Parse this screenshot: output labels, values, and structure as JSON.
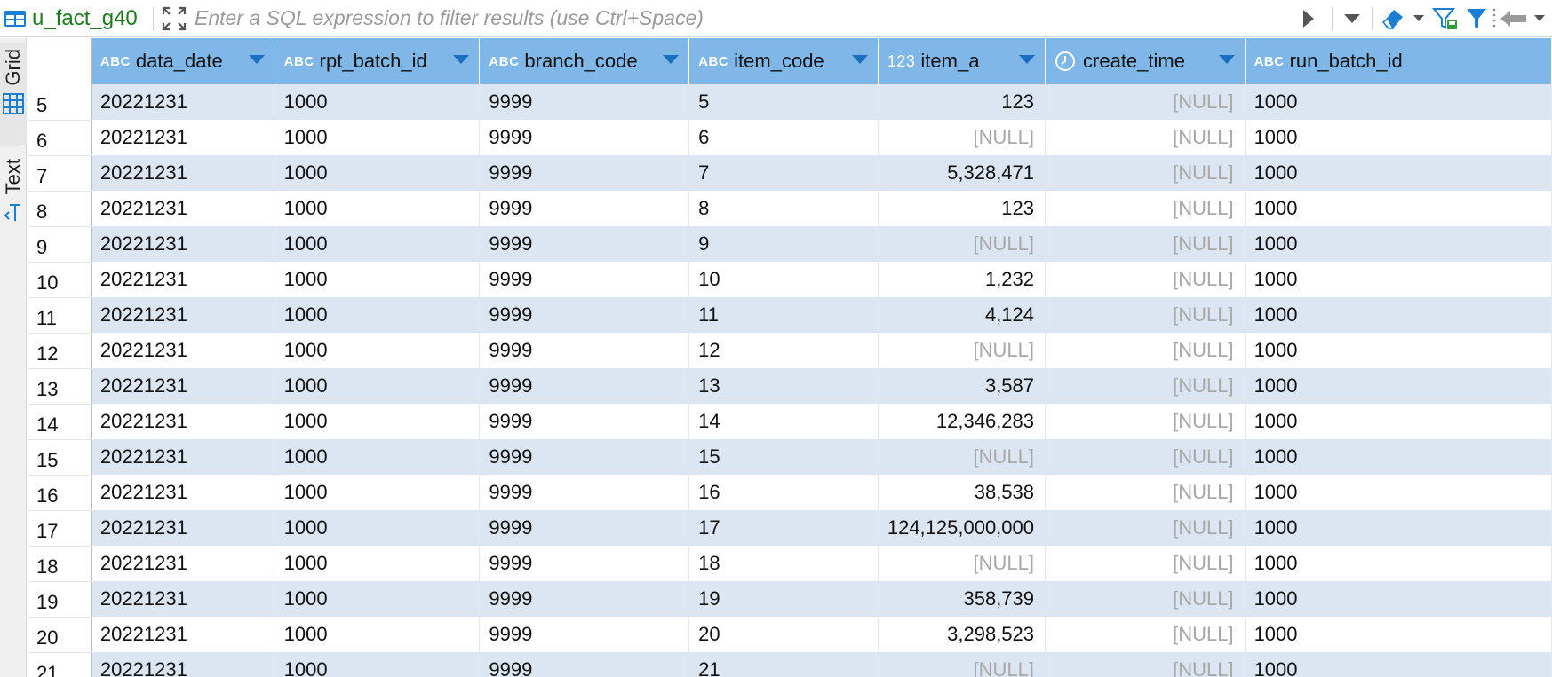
{
  "toolbar": {
    "table_name": "u_fact_g40",
    "filter_placeholder": "Enter a SQL expression to filter results (use Ctrl+Space)"
  },
  "side_tabs": {
    "grid": "Grid",
    "text": "Text"
  },
  "columns": [
    {
      "type": "ABC",
      "name": "data_date"
    },
    {
      "type": "ABC",
      "name": "rpt_batch_id"
    },
    {
      "type": "ABC",
      "name": "branch_code"
    },
    {
      "type": "ABC",
      "name": "item_code"
    },
    {
      "type": "123",
      "name": "item_a"
    },
    {
      "type": "clock-icon",
      "name": "create_time"
    },
    {
      "type": "ABC",
      "name": "run_batch_id"
    }
  ],
  "rows": [
    {
      "rn": "5",
      "data_date": "20221231",
      "rpt_batch_id": "1000",
      "branch_code": "9999",
      "item_code": "5",
      "item_a": "123",
      "create_time": "[NULL]",
      "run_batch_id": "1000"
    },
    {
      "rn": "6",
      "data_date": "20221231",
      "rpt_batch_id": "1000",
      "branch_code": "9999",
      "item_code": "6",
      "item_a": "[NULL]",
      "create_time": "[NULL]",
      "run_batch_id": "1000"
    },
    {
      "rn": "7",
      "data_date": "20221231",
      "rpt_batch_id": "1000",
      "branch_code": "9999",
      "item_code": "7",
      "item_a": "5,328,471",
      "create_time": "[NULL]",
      "run_batch_id": "1000"
    },
    {
      "rn": "8",
      "data_date": "20221231",
      "rpt_batch_id": "1000",
      "branch_code": "9999",
      "item_code": "8",
      "item_a": "123",
      "create_time": "[NULL]",
      "run_batch_id": "1000"
    },
    {
      "rn": "9",
      "data_date": "20221231",
      "rpt_batch_id": "1000",
      "branch_code": "9999",
      "item_code": "9",
      "item_a": "[NULL]",
      "create_time": "[NULL]",
      "run_batch_id": "1000"
    },
    {
      "rn": "10",
      "data_date": "20221231",
      "rpt_batch_id": "1000",
      "branch_code": "9999",
      "item_code": "10",
      "item_a": "1,232",
      "create_time": "[NULL]",
      "run_batch_id": "1000"
    },
    {
      "rn": "11",
      "data_date": "20221231",
      "rpt_batch_id": "1000",
      "branch_code": "9999",
      "item_code": "11",
      "item_a": "4,124",
      "create_time": "[NULL]",
      "run_batch_id": "1000"
    },
    {
      "rn": "12",
      "data_date": "20221231",
      "rpt_batch_id": "1000",
      "branch_code": "9999",
      "item_code": "12",
      "item_a": "[NULL]",
      "create_time": "[NULL]",
      "run_batch_id": "1000"
    },
    {
      "rn": "13",
      "data_date": "20221231",
      "rpt_batch_id": "1000",
      "branch_code": "9999",
      "item_code": "13",
      "item_a": "3,587",
      "create_time": "[NULL]",
      "run_batch_id": "1000"
    },
    {
      "rn": "14",
      "data_date": "20221231",
      "rpt_batch_id": "1000",
      "branch_code": "9999",
      "item_code": "14",
      "item_a": "12,346,283",
      "create_time": "[NULL]",
      "run_batch_id": "1000"
    },
    {
      "rn": "15",
      "data_date": "20221231",
      "rpt_batch_id": "1000",
      "branch_code": "9999",
      "item_code": "15",
      "item_a": "[NULL]",
      "create_time": "[NULL]",
      "run_batch_id": "1000"
    },
    {
      "rn": "16",
      "data_date": "20221231",
      "rpt_batch_id": "1000",
      "branch_code": "9999",
      "item_code": "16",
      "item_a": "38,538",
      "create_time": "[NULL]",
      "run_batch_id": "1000"
    },
    {
      "rn": "17",
      "data_date": "20221231",
      "rpt_batch_id": "1000",
      "branch_code": "9999",
      "item_code": "17",
      "item_a": "124,125,000,000",
      "create_time": "[NULL]",
      "run_batch_id": "1000"
    },
    {
      "rn": "18",
      "data_date": "20221231",
      "rpt_batch_id": "1000",
      "branch_code": "9999",
      "item_code": "18",
      "item_a": "[NULL]",
      "create_time": "[NULL]",
      "run_batch_id": "1000"
    },
    {
      "rn": "19",
      "data_date": "20221231",
      "rpt_batch_id": "1000",
      "branch_code": "9999",
      "item_code": "19",
      "item_a": "358,739",
      "create_time": "[NULL]",
      "run_batch_id": "1000"
    },
    {
      "rn": "20",
      "data_date": "20221231",
      "rpt_batch_id": "1000",
      "branch_code": "9999",
      "item_code": "20",
      "item_a": "3,298,523",
      "create_time": "[NULL]",
      "run_batch_id": "1000"
    },
    {
      "rn": "21",
      "data_date": "20221231",
      "rpt_batch_id": "1000",
      "branch_code": "9999",
      "item_code": "21",
      "item_a": "[NULL]",
      "create_time": "[NULL]",
      "run_batch_id": "1000"
    }
  ],
  "colors": {
    "header_bg": "#7fb8e8",
    "row_alt": "#dce6f2",
    "null_text": "#a8a8a8",
    "table_name": "#1f7a1f",
    "accent": "#1a7fd4"
  }
}
